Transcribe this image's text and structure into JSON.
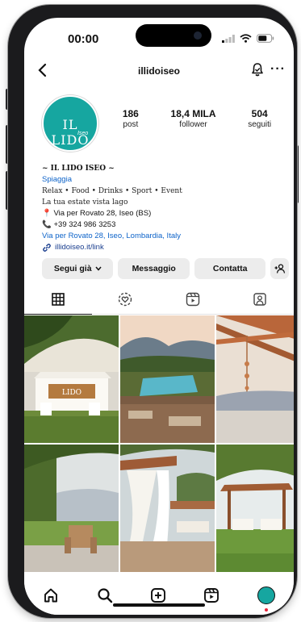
{
  "status_bar": {
    "time": "00:00"
  },
  "header": {
    "username": "illidoiseo"
  },
  "profile": {
    "avatar_text": "IL LIDO",
    "avatar_sub": "Iseo",
    "stats": [
      {
        "value": "186",
        "label": "post"
      },
      {
        "value": "18,4 MILA",
        "label": "follower"
      },
      {
        "value": "504",
        "label": "seguiti"
      }
    ]
  },
  "bio": {
    "name": "~ IL LIDO ISEO ~",
    "category": "Spiaggia",
    "line1": "Relax • Food • Drinks • Sport • Event",
    "line2": "La tua estate vista lago",
    "location": "Via per Rovato 28, Iseo (BS)",
    "phone": "+39 324 986 3253",
    "address": "Via per Rovato 28, Iseo, Lombardia, Italy",
    "link": "illidoiseo.it/link"
  },
  "buttons": {
    "following": "Segui già",
    "message": "Messaggio",
    "contact": "Contatta"
  },
  "tabs": [
    "grid-icon",
    "reels-heart-icon",
    "video-icon",
    "tagged-icon"
  ],
  "colors": {
    "brand_teal": "#16a6a0",
    "link_blue": "#0d63c9",
    "button_gray": "#ececec"
  }
}
